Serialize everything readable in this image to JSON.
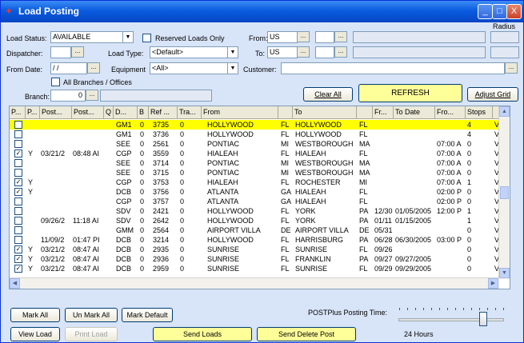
{
  "window": {
    "title": "Load Posting",
    "minimize": "_",
    "maximize": "□",
    "close": "X"
  },
  "filters": {
    "load_status_label": "Load Status:",
    "load_status_value": "AVAILABLE",
    "reserved_only_label": "Reserved Loads Only",
    "dispatcher_label": "Dispatcher:",
    "dispatcher_value": "",
    "load_type_label": "Load Type:",
    "load_type_value": "<Default>",
    "from_date_label": "From Date:",
    "from_date_value": "/ /",
    "equipment_label": "Equipment",
    "equipment_value": "<All>",
    "all_branches_label": "All Branches / Offices",
    "branch_label": "Branch:",
    "branch_value": "0",
    "from_label": "From:",
    "from_value": "US",
    "to_label": "To:",
    "to_value": "US",
    "customer_label": "Customer:",
    "radius_label": "Radius",
    "ellipsis": "..."
  },
  "actions": {
    "clear_all": "Clear All",
    "refresh": "REFRESH",
    "adjust_grid": "Adjust Grid",
    "mark_all": "Mark All",
    "unmark_all": "Un Mark All",
    "mark_default": "Mark Default",
    "view_load": "View Load",
    "print_load": "Print Load",
    "send_loads": "Send Loads",
    "send_delete_post": "Send Delete Post"
  },
  "posting": {
    "time_label": "POSTPlus Posting Time:",
    "time_value": "24 Hours",
    "level": 0.8
  },
  "grid": {
    "headers": [
      "P...",
      "P...",
      "Post...",
      "Post...",
      "Q",
      "D...",
      "B",
      "Ref ...",
      "Tra...",
      "From",
      "",
      "To",
      "",
      "Fr...",
      "To Date",
      "Fro...",
      "Stops",
      ""
    ],
    "rows": [
      {
        "chk": false,
        "p": "",
        "pd": "",
        "pt": "",
        "d": "GM1",
        "b": "0",
        "ref": "3735",
        "tra": "0",
        "from": "HOLLYWOOD",
        "fs": "FL",
        "to": "HOLLYWOOD",
        "ts": "FL",
        "fr": "",
        "todate": "",
        "fro": "",
        "stops": "4",
        "v": "V",
        "hl": true
      },
      {
        "chk": false,
        "p": "",
        "pd": "",
        "pt": "",
        "d": "GM1",
        "b": "0",
        "ref": "3736",
        "tra": "0",
        "from": "HOLLYWOOD",
        "fs": "FL",
        "to": "HOLLYWOOD",
        "ts": "FL",
        "fr": "",
        "todate": "",
        "fro": "",
        "stops": "4",
        "v": "V",
        "hl": false
      },
      {
        "chk": false,
        "p": "",
        "pd": "",
        "pt": "",
        "d": "SEE",
        "b": "0",
        "ref": "2561",
        "tra": "0",
        "from": "PONTIAC",
        "fs": "MI",
        "to": "WESTBOROUGH",
        "ts": "MA",
        "fr": "",
        "todate": "",
        "fro": "07:00 A",
        "stops": "0",
        "v": "V",
        "hl": false
      },
      {
        "chk": true,
        "p": "Y",
        "pd": "03/21/2",
        "pt": "08:48 AI",
        "d": "CGP",
        "b": "0",
        "ref": "3559",
        "tra": "0",
        "from": "HIALEAH",
        "fs": "FL",
        "to": "HIALEAH",
        "ts": "FL",
        "fr": "",
        "todate": "",
        "fro": "07:00 A",
        "stops": "0",
        "v": "V",
        "hl": false
      },
      {
        "chk": false,
        "p": "",
        "pd": "",
        "pt": "",
        "d": "SEE",
        "b": "0",
        "ref": "3714",
        "tra": "0",
        "from": "PONTIAC",
        "fs": "MI",
        "to": "WESTBOROUGH",
        "ts": "MA",
        "fr": "",
        "todate": "",
        "fro": "07:00 A",
        "stops": "0",
        "v": "V",
        "hl": false
      },
      {
        "chk": false,
        "p": "",
        "pd": "",
        "pt": "",
        "d": "SEE",
        "b": "0",
        "ref": "3715",
        "tra": "0",
        "from": "PONTIAC",
        "fs": "MI",
        "to": "WESTBOROUGH",
        "ts": "MA",
        "fr": "",
        "todate": "",
        "fro": "07:00 A",
        "stops": "0",
        "v": "V",
        "hl": false
      },
      {
        "chk": true,
        "p": "Y",
        "pd": "",
        "pt": "",
        "d": "CGP",
        "b": "0",
        "ref": "3753",
        "tra": "0",
        "from": "HIALEAH",
        "fs": "FL",
        "to": "ROCHESTER",
        "ts": "MI",
        "fr": "",
        "todate": "",
        "fro": "07:00 A",
        "stops": "1",
        "v": "V",
        "hl": false
      },
      {
        "chk": true,
        "p": "Y",
        "pd": "",
        "pt": "",
        "d": "DCB",
        "b": "0",
        "ref": "3756",
        "tra": "0",
        "from": "ATLANTA",
        "fs": "GA",
        "to": "HIALEAH",
        "ts": "FL",
        "fr": "",
        "todate": "",
        "fro": "02:00 P",
        "stops": "0",
        "v": "V",
        "hl": false
      },
      {
        "chk": false,
        "p": "",
        "pd": "",
        "pt": "",
        "d": "CGP",
        "b": "0",
        "ref": "3757",
        "tra": "0",
        "from": "ATLANTA",
        "fs": "GA",
        "to": "HIALEAH",
        "ts": "FL",
        "fr": "",
        "todate": "",
        "fro": "02:00 P",
        "stops": "0",
        "v": "V",
        "hl": false
      },
      {
        "chk": false,
        "p": "",
        "pd": "",
        "pt": "",
        "d": "SDV",
        "b": "0",
        "ref": "2421",
        "tra": "0",
        "from": "HOLLYWOOD",
        "fs": "FL",
        "to": "YORK",
        "ts": "PA",
        "fr": "12/30",
        "todate": "01/05/2005",
        "fro": "12:00 P",
        "stops": "1",
        "v": "V",
        "hl": false
      },
      {
        "chk": false,
        "p": "",
        "pd": "09/26/2",
        "pt": "11:18 AI",
        "d": "SDV",
        "b": "0",
        "ref": "2642",
        "tra": "0",
        "from": "HOLLYWOOD",
        "fs": "FL",
        "to": "YORK",
        "ts": "PA",
        "fr": "01/11",
        "todate": "01/15/2005",
        "fro": "",
        "stops": "1",
        "v": "V",
        "hl": false
      },
      {
        "chk": false,
        "p": "",
        "pd": "",
        "pt": "",
        "d": "GMM",
        "b": "0",
        "ref": "2564",
        "tra": "0",
        "from": "AIRPORT VILLA",
        "fs": "DE",
        "to": "AIRPORT VILLA",
        "ts": "DE",
        "fr": "05/31",
        "todate": "",
        "fro": "",
        "stops": "0",
        "v": "V",
        "hl": false
      },
      {
        "chk": false,
        "p": "",
        "pd": "11/09/2",
        "pt": "01:47 PI",
        "d": "DCB",
        "b": "0",
        "ref": "3214",
        "tra": "0",
        "from": "HOLLYWOOD",
        "fs": "FL",
        "to": "HARRISBURG",
        "ts": "PA",
        "fr": "06/28",
        "todate": "06/30/2005",
        "fro": "03:00 P",
        "stops": "0",
        "v": "V",
        "hl": false
      },
      {
        "chk": true,
        "p": "Y",
        "pd": "03/21/2",
        "pt": "08:47 AI",
        "d": "DCB",
        "b": "0",
        "ref": "2935",
        "tra": "0",
        "from": "SUNRISE",
        "fs": "FL",
        "to": "SUNRISE",
        "ts": "FL",
        "fr": "09/26",
        "todate": "",
        "fro": "",
        "stops": "0",
        "v": "V",
        "hl": false
      },
      {
        "chk": true,
        "p": "Y",
        "pd": "03/21/2",
        "pt": "08:47 AI",
        "d": "DCB",
        "b": "0",
        "ref": "2936",
        "tra": "0",
        "from": "SUNRISE",
        "fs": "FL",
        "to": "FRANKLIN",
        "ts": "PA",
        "fr": "09/27",
        "todate": "09/27/2005",
        "fro": "",
        "stops": "0",
        "v": "V",
        "hl": false
      },
      {
        "chk": true,
        "p": "Y",
        "pd": "03/21/2",
        "pt": "08:47 AI",
        "d": "DCB",
        "b": "0",
        "ref": "2959",
        "tra": "0",
        "from": "SUNRISE",
        "fs": "FL",
        "to": "SUNRISE",
        "ts": "FL",
        "fr": "09/29",
        "todate": "09/29/2005",
        "fro": "",
        "stops": "0",
        "v": "V",
        "hl": false
      }
    ]
  }
}
